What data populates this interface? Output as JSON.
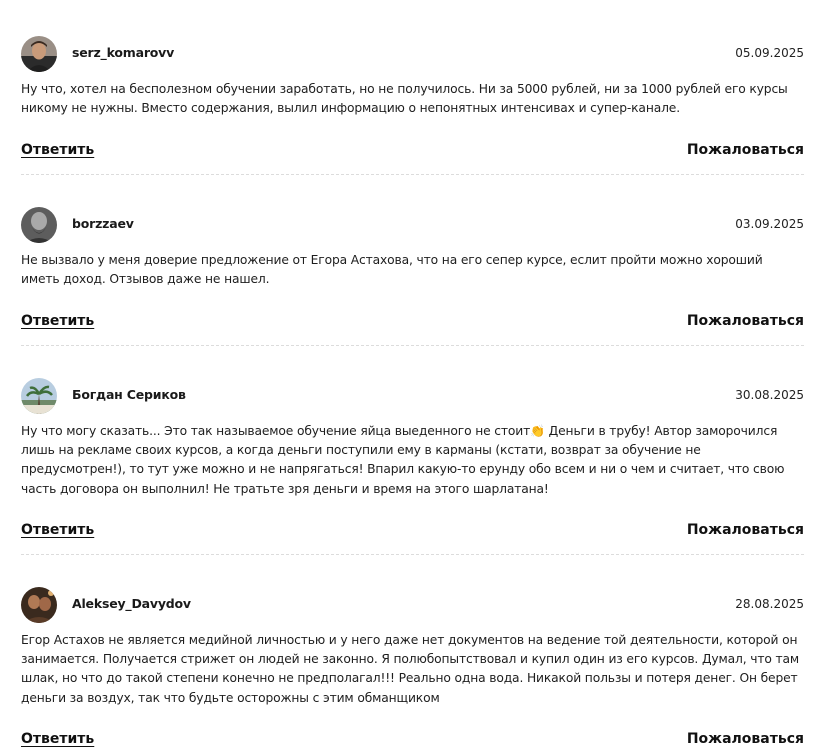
{
  "actions": {
    "reply_label": "Ответить",
    "complain_label": "Пожаловаться"
  },
  "reviews": [
    {
      "author": "serz_komarovv",
      "date": "05.09.2025",
      "text": "Ну что, хотел на бесполезном обучении заработать, но не получилось. Ни за 5000 рублей, ни за 1000 рублей его курсы никому не нужны. Вместо содержания, вылил информацию о непонятных интенсивах и супер-канале."
    },
    {
      "author": "borzzaev",
      "date": "03.09.2025",
      "text": "Не вызвало у меня доверие предложение от Егора Астахова, что на его сепер курсе, еслит пройти можно хороший иметь доход. Отзывов даже не нашел."
    },
    {
      "author": "Богдан Сериков",
      "date": "30.08.2025",
      "text_before": "Ну что могу сказать... Это так называемое обучение яйца выеденного не стоит",
      "emoji": "👏",
      "text_after": " Деньги в трубу! Автор заморочился лишь на рекламе своих курсов, а когда деньги поступили ему в карманы (кстати, возврат за обучение не предусмотрен!), то тут уже можно и не напрягаться! Впарил какую-то ерунду обо всем и ни о чем и считает, что свою часть договора он выполнил! Не тратьте зря деньги и время на этого шарлатана!"
    },
    {
      "author": "Aleksey_Davydov",
      "date": "28.08.2025",
      "text": "Егор Астахов не является медийной личностью и у него даже нет документов на ведение той деятельности, которой он занимается. Получается стрижет он людей не законно. Я полюбопытствовал и купил один из его курсов. Думал, что там шлак, но что до такой степени конечно не предполагал!!! Реально одна вода. Никакой пользы и потеря денег. Он берет деньги за воздух, так что будьте осторожны с этим обманщиком"
    }
  ]
}
